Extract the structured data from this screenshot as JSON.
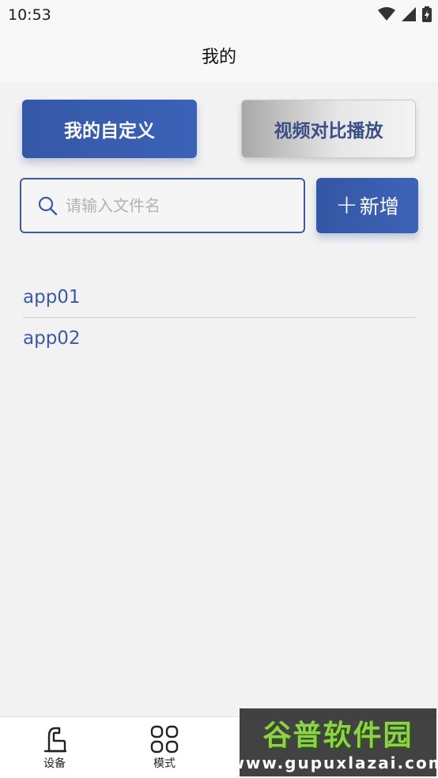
{
  "status_bar": {
    "time": "10:53",
    "icons": [
      "wifi-icon",
      "signal-icon",
      "battery-charging-icon"
    ]
  },
  "header": {
    "title": "我的"
  },
  "top_buttons": {
    "primary_label": "我的自定义",
    "secondary_label": "视频对比播放"
  },
  "search": {
    "placeholder": "请输入文件名",
    "value": ""
  },
  "add_button": {
    "plus": "+",
    "label": "新增"
  },
  "files": [
    {
      "name": "app01"
    },
    {
      "name": "app02"
    }
  ],
  "bottom_nav": [
    {
      "label": "设备",
      "icon": "device-icon"
    },
    {
      "label": "模式",
      "icon": "grid-icon"
    }
  ],
  "watermark": {
    "title": "谷普软件园",
    "url": "www.gupuxlazai.com"
  },
  "colors": {
    "accent": "#3b5aa5",
    "primary_button": "#3a5cad",
    "background": "#f2f2f3",
    "header_bg": "#f8f8f8"
  }
}
